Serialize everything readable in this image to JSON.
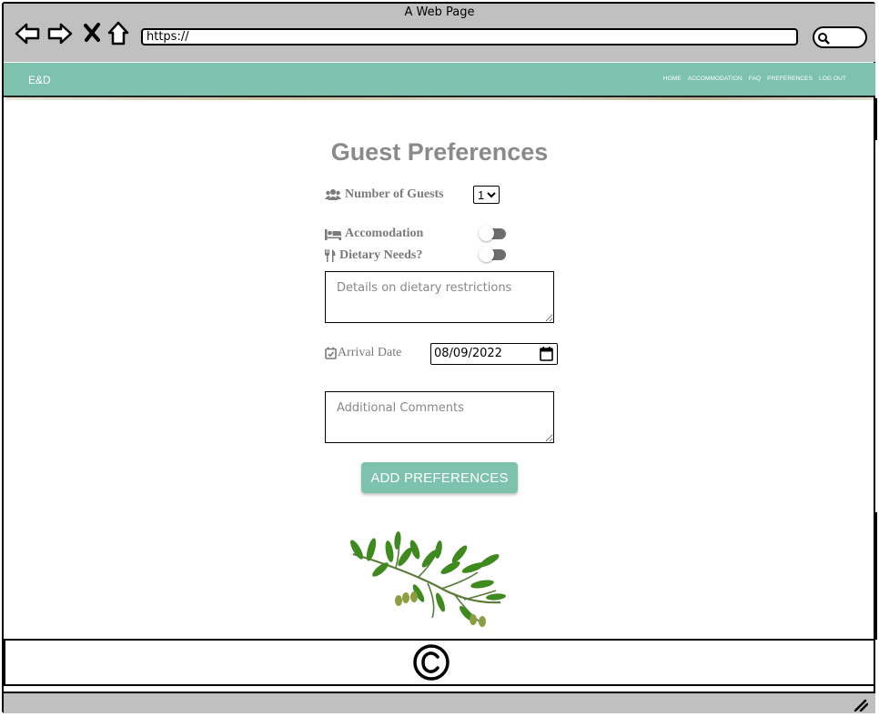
{
  "window": {
    "title": "A Web Page"
  },
  "browser": {
    "url": "https://"
  },
  "site": {
    "brand": "E&D",
    "nav": [
      "HOME",
      "ACCOMMODATION",
      "FAQ",
      "PREFERENCES",
      "LOG OUT"
    ],
    "accent_color": "#7cc2ad"
  },
  "form": {
    "title": "Guest Preferences",
    "guests_label": "Number of Guests",
    "guests_value": "1",
    "accommodation_label": "Accomodation",
    "accommodation_on": false,
    "dietary_label": "Dietary Needs?",
    "dietary_on": false,
    "dietary_placeholder": "Details on dietary restrictions",
    "arrival_label": "Arrival Date",
    "arrival_value": "08/09/2022",
    "comments_placeholder": "Additional Comments",
    "submit_label": "ADD PREFERENCES"
  },
  "icons": {
    "guests": "users-icon",
    "accommodation": "bed-icon",
    "dietary": "utensils-icon",
    "arrival": "calendar-check-icon",
    "decoration": "olive-branch-icon",
    "footer": "copyright-icon"
  }
}
